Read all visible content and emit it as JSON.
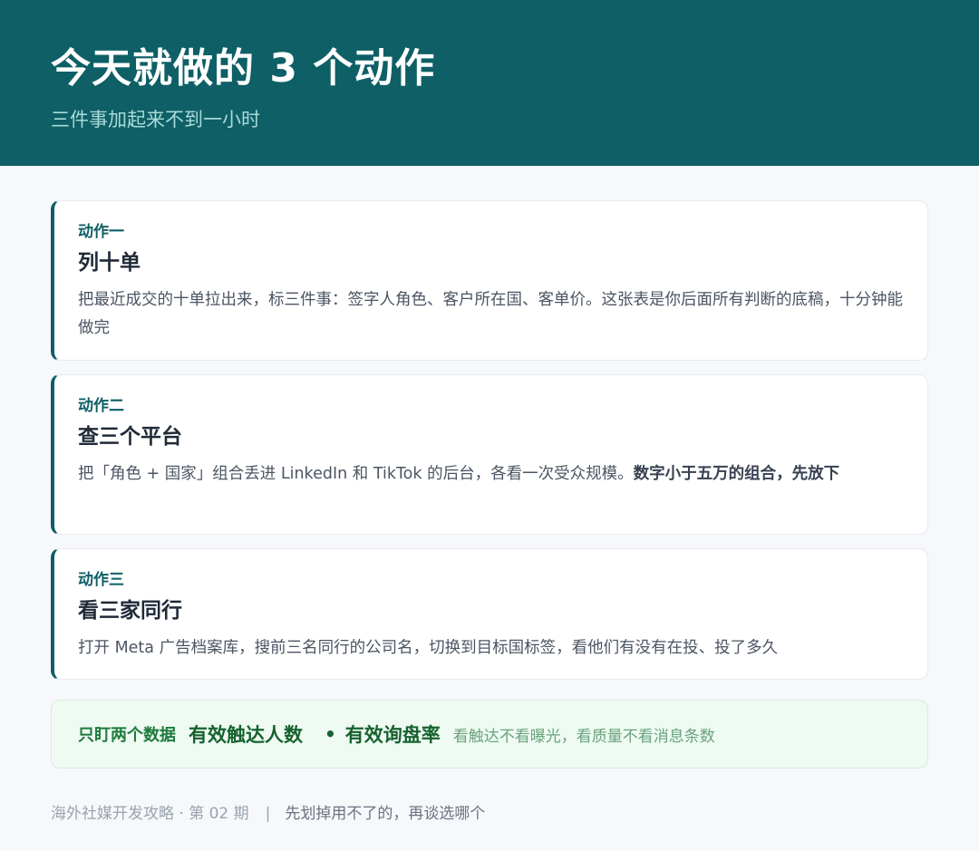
{
  "header": {
    "title": "今天就做的 3 个动作",
    "subtitle": "三件事加起来不到一小时"
  },
  "actions": [
    {
      "tag": "动作一",
      "heading": "列十单",
      "desc": "把最近成交的十单拉出来，标三件事：签字人角色、客户所在国、客单价。这张表是你后面所有判断的底稿，十分钟能做完",
      "desc_strong": ""
    },
    {
      "tag": "动作二",
      "heading": "查三个平台",
      "desc": "把「角色 + 国家」组合丢进 LinkedIn 和 TikTok 的后台，各看一次受众规模。",
      "desc_strong": "数字小于五万的组合，先放下"
    },
    {
      "tag": "动作三",
      "heading": "看三家同行",
      "desc": "打开 Meta 广告档案库，搜前三名同行的公司名，切换到目标国标签，看他们有没有在投、投了多久",
      "desc_strong": ""
    }
  ],
  "focus": {
    "lead": "只盯两个数据",
    "metric_1": "有效触达人数",
    "dot": "•",
    "metric_2": "有效询盘率",
    "note": "看触达不看曝光，看质量不看消息条数"
  },
  "footer": {
    "source": "海外社媒开发攻略 · 第 02 期",
    "separator": "|",
    "tip": "先划掉用不了的，再谈选哪个"
  }
}
